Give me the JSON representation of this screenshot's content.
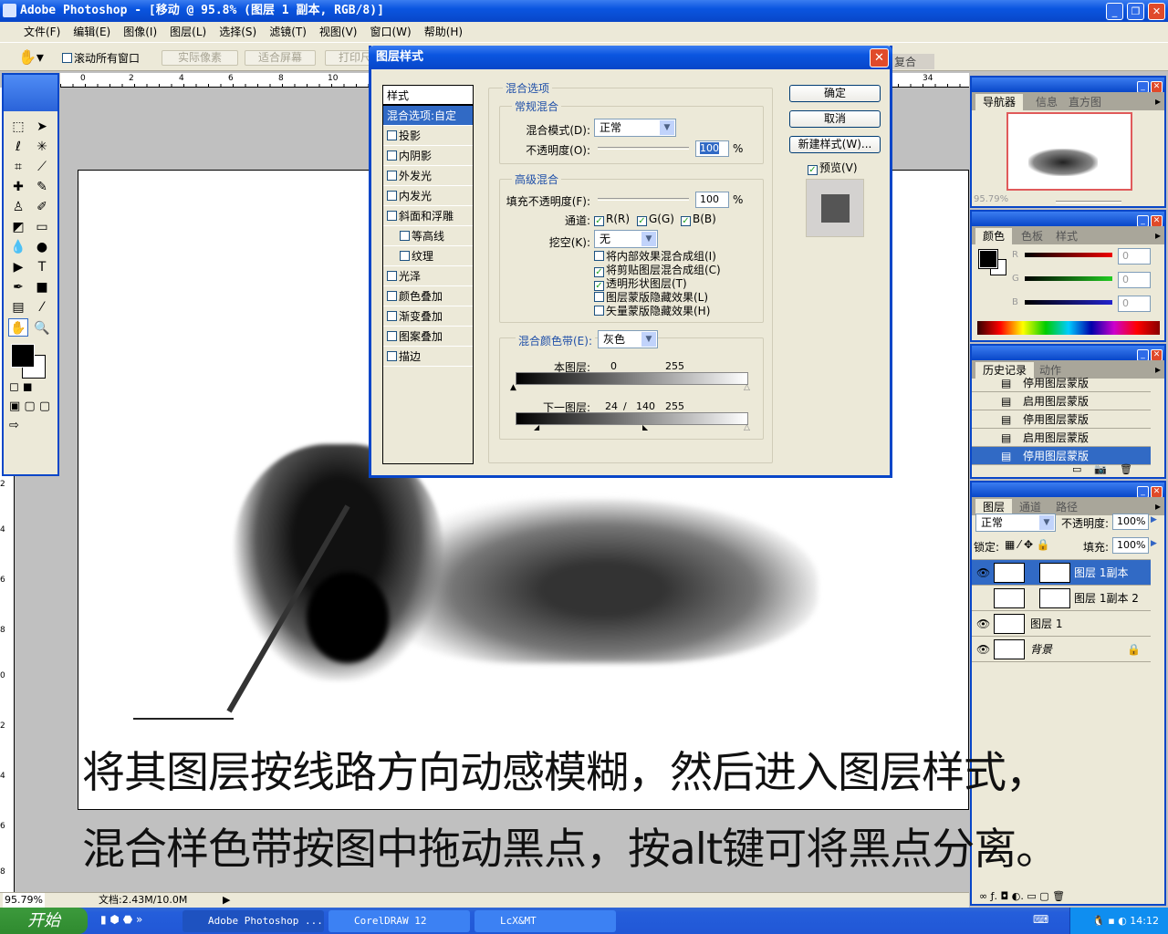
{
  "window": {
    "title": "Adobe Photoshop - [移动 @ 95.8% (图层 1 副本, RGB/8)]"
  },
  "menu": [
    "文件(F)",
    "编辑(E)",
    "图像(I)",
    "图层(L)",
    "选择(S)",
    "滤镜(T)",
    "视图(V)",
    "窗口(W)",
    "帮助(H)"
  ],
  "options": {
    "scroll_all": "滚动所有窗口",
    "actual_pixels": "实际像素",
    "fit_screen": "适合屏幕",
    "print_size": "打印尺寸",
    "palette_well": "复合"
  },
  "ruler": {
    "top": [
      "0",
      "2",
      "4",
      "6",
      "8",
      "10",
      "34"
    ],
    "left": [
      "2",
      "4",
      "6",
      "8",
      "0",
      "2",
      "4",
      "6",
      "8"
    ]
  },
  "dialog": {
    "title": "图层样式",
    "styles_header": "样式",
    "styles": [
      {
        "label": "混合选项:自定",
        "selected": true,
        "checkbox": false
      },
      {
        "label": "投影",
        "checkbox": true
      },
      {
        "label": "内阴影",
        "checkbox": true
      },
      {
        "label": "外发光",
        "checkbox": true
      },
      {
        "label": "内发光",
        "checkbox": true
      },
      {
        "label": "斜面和浮雕",
        "checkbox": true
      },
      {
        "label": "等高线",
        "checkbox": true,
        "sub": true
      },
      {
        "label": "纹理",
        "checkbox": true,
        "sub": true
      },
      {
        "label": "光泽",
        "checkbox": true
      },
      {
        "label": "颜色叠加",
        "checkbox": true
      },
      {
        "label": "渐变叠加",
        "checkbox": true
      },
      {
        "label": "图案叠加",
        "checkbox": true
      },
      {
        "label": "描边",
        "checkbox": true
      }
    ],
    "blend_options": "混合选项",
    "general": "常规混合",
    "blend_mode_label": "混合模式(D):",
    "blend_mode": "正常",
    "opacity_label": "不透明度(O):",
    "opacity": "100",
    "pct": "%",
    "advanced": "高级混合",
    "fill_label": "填充不透明度(F):",
    "fill": "100",
    "channels_label": "通道:",
    "ch_r": "R(R)",
    "ch_g": "G(G)",
    "ch_b": "B(B)",
    "knockout_label": "挖空(K):",
    "knockout": "无",
    "checks": [
      {
        "label": "将内部效果混合成组(I)",
        "checked": false
      },
      {
        "label": "将剪贴图层混合成组(C)",
        "checked": true
      },
      {
        "label": "透明形状图层(T)",
        "checked": true
      },
      {
        "label": "图层蒙版隐藏效果(L)",
        "checked": false
      },
      {
        "label": "矢量蒙版隐藏效果(H)",
        "checked": false
      }
    ],
    "blend_if_label": "混合颜色带(E):",
    "blend_if": "灰色",
    "this_layer": "本图层:",
    "this_low": "0",
    "this_high": "255",
    "under_layer": "下一图层:",
    "under_low": "24",
    "under_sep": "/",
    "under_mid": "140",
    "under_high": "255",
    "ok": "确定",
    "cancel": "取消",
    "new_style": "新建样式(W)...",
    "preview": "预览(V)"
  },
  "navigator": {
    "tabs": [
      "导航器",
      "信息",
      "直方图"
    ],
    "zoom": "95.79%"
  },
  "color": {
    "tabs": [
      "颜色",
      "色板",
      "样式"
    ],
    "r_label": "R",
    "g_label": "G",
    "b_label": "B",
    "r": "0",
    "g": "0",
    "b": "0",
    "foreground": "#000000",
    "background": "#ffffff"
  },
  "history": {
    "tabs": [
      "历史记录",
      "动作"
    ],
    "items": [
      "停用图层蒙版",
      "启用图层蒙版",
      "停用图层蒙版",
      "启用图层蒙版",
      "停用图层蒙版"
    ]
  },
  "layers": {
    "tabs": [
      "图层",
      "通道",
      "路径"
    ],
    "mode": "正常",
    "opacity_label": "不透明度:",
    "opacity": "100%",
    "lock_label": "锁定:",
    "fill_label": "填充:",
    "fill": "100%",
    "items": [
      {
        "name": "图层 1副本",
        "visible": true,
        "selected": true
      },
      {
        "name": "图层 1副本 2",
        "visible": false
      },
      {
        "name": "图层 1",
        "visible": true
      },
      {
        "name": "背景",
        "visible": true,
        "locked": true
      }
    ]
  },
  "caption": {
    "line1": "将其图层按线路方向动感模糊，然后进入图层样式，",
    "line2": "混合样色带按图中拖动黑点，按alt键可将黑点分离。"
  },
  "status": {
    "zoom": "95.79%",
    "doc": "文档:2.43M/10.0M"
  },
  "taskbar": {
    "start": "开始",
    "tasks": [
      "Adobe Photoshop ...",
      "CorelDRAW 12",
      "LcX&MT"
    ],
    "clock": "14:12"
  }
}
